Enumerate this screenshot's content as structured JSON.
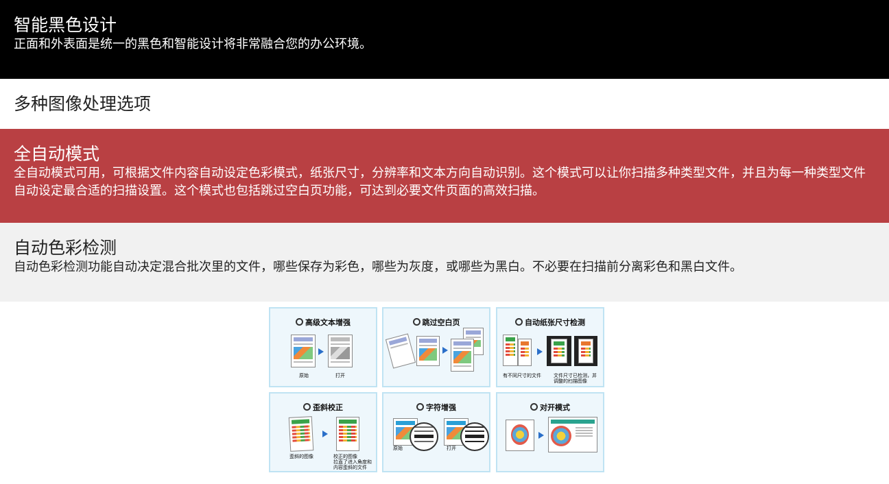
{
  "sections": {
    "smart_black": {
      "title": "智能黑色设计",
      "text": "正面和外表面是统一的黑色和智能设计将非常融合您的办公环境。"
    },
    "image_options": {
      "title": "多种图像处理选项"
    },
    "auto_mode": {
      "title": "全自动模式",
      "text": "全自动模式可用，可根据文件内容自动设定色彩模式，纸张尺寸，分辨率和文本方向自动识别。这个模式可以让你扫描多种类型文件，并且为每一种类型文件自动设定最合适的扫描设置。这个模式也包括跳过空白页功能，可达到必要文件页面的高效扫描。"
    },
    "color_detect": {
      "title": "自动色彩检测",
      "text": "自动色彩检测功能自动决定混合批次里的文件，哪些保存为彩色，哪些为灰度，或哪些为黑白。不必要在扫描前分离彩色和黑白文件。"
    }
  },
  "features": {
    "text_enhance": {
      "title": "高级文本增强",
      "cap_left": "原始",
      "cap_right": "打开"
    },
    "skip_blank": {
      "title": "跳过空白页"
    },
    "paper_size": {
      "title": "自动纸张尺寸检测",
      "cap_left": "有不同尺寸的文件",
      "cap_right_1": "文件尺寸已检测，并",
      "cap_right_2": "调整的扫描图像"
    },
    "deskew": {
      "title": "歪斜校正",
      "cap_left": "歪斜的图像",
      "cap_right_1": "校正的图像",
      "cap_right_2": "拉直了进入角度和",
      "cap_right_3": "内容歪斜的文件"
    },
    "char_enhance": {
      "title": "字符增强",
      "cap_left": "原始",
      "cap_right": "打开"
    },
    "split": {
      "title": "对开模式"
    }
  }
}
